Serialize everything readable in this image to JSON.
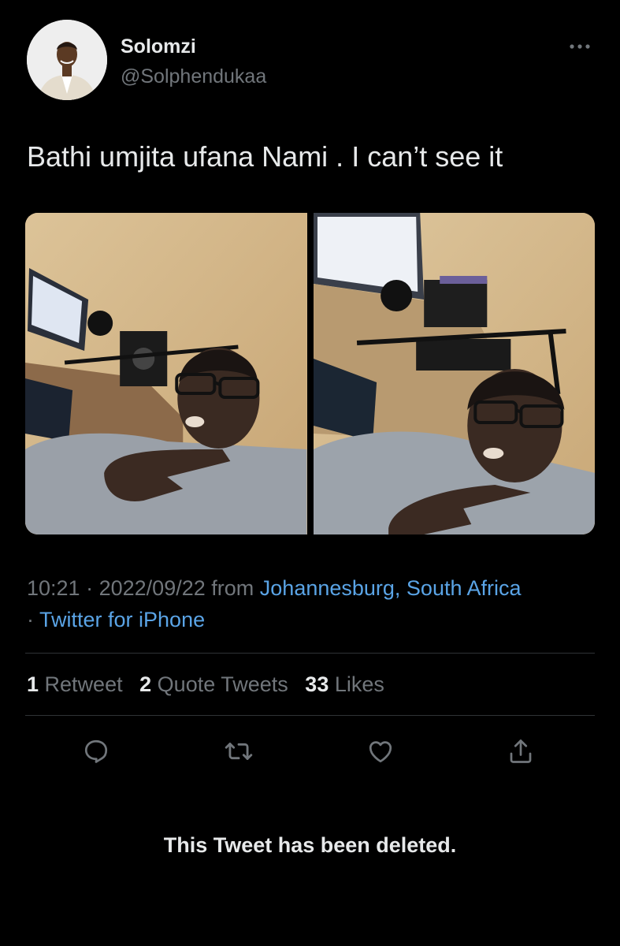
{
  "author": {
    "display_name": "Solomzi",
    "handle": "@Solphendukaa"
  },
  "tweet": {
    "text": "Bathi umjita ufana Nami . I can’t see it",
    "time": "10:21",
    "separator": "·",
    "date": "2022/09/22",
    "from_label": "from",
    "location": "Johannesburg, South Africa",
    "source": "Twitter for iPhone"
  },
  "stats": {
    "retweets_count": "1",
    "retweets_label": "Retweet",
    "quotes_count": "2",
    "quotes_label": "Quote Tweets",
    "likes_count": "33",
    "likes_label": "Likes"
  },
  "actions": {
    "icons": [
      "reply-icon",
      "retweet-icon",
      "like-icon",
      "share-icon"
    ]
  },
  "quoted_tweet": {
    "notice": "This Tweet has been deleted."
  },
  "colors": {
    "background": "#000000",
    "primary_text": "#e7e9ea",
    "secondary_text": "#71767b",
    "link": "#5aa4e6",
    "divider": "#2f3336"
  }
}
